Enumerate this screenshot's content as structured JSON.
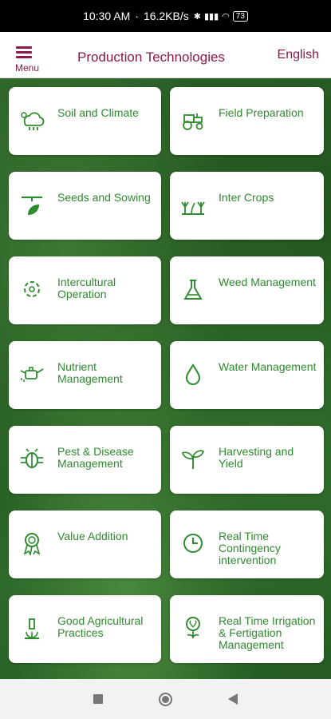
{
  "status": {
    "time": "10:30 AM",
    "dot": "·",
    "speed": "16.2KB/s",
    "battery": "73"
  },
  "header": {
    "menu_label": "Menu",
    "title": "Production Technologies",
    "language": "English"
  },
  "tiles": [
    {
      "label": "Soil and Climate",
      "icon": "soil-climate-icon"
    },
    {
      "label": "Field Preparation",
      "icon": "tractor-icon"
    },
    {
      "label": "Seeds and Sowing",
      "icon": "seed-sowing-icon"
    },
    {
      "label": "Inter Crops",
      "icon": "inter-crops-icon"
    },
    {
      "label": "Intercultural Operation",
      "icon": "intercultural-icon"
    },
    {
      "label": "Weed Management",
      "icon": "flask-icon"
    },
    {
      "label": "Nutrient Management",
      "icon": "nutrient-can-icon"
    },
    {
      "label": "Water Management",
      "icon": "water-drop-icon"
    },
    {
      "label": "Pest & Disease Management",
      "icon": "bug-icon"
    },
    {
      "label": "Harvesting and Yield",
      "icon": "sprout-icon"
    },
    {
      "label": "Value Addition",
      "icon": "award-icon"
    },
    {
      "label": "Real Time Contingency intervention",
      "icon": "clock-icon"
    },
    {
      "label": "Good Agricultural Practices",
      "icon": "microscope-icon"
    },
    {
      "label": "Real Time Irrigation & Fertigation Management",
      "icon": "irrigation-icon"
    }
  ],
  "colors": {
    "brand": "#8b1a4a",
    "tile_text": "#2e8b2e"
  }
}
